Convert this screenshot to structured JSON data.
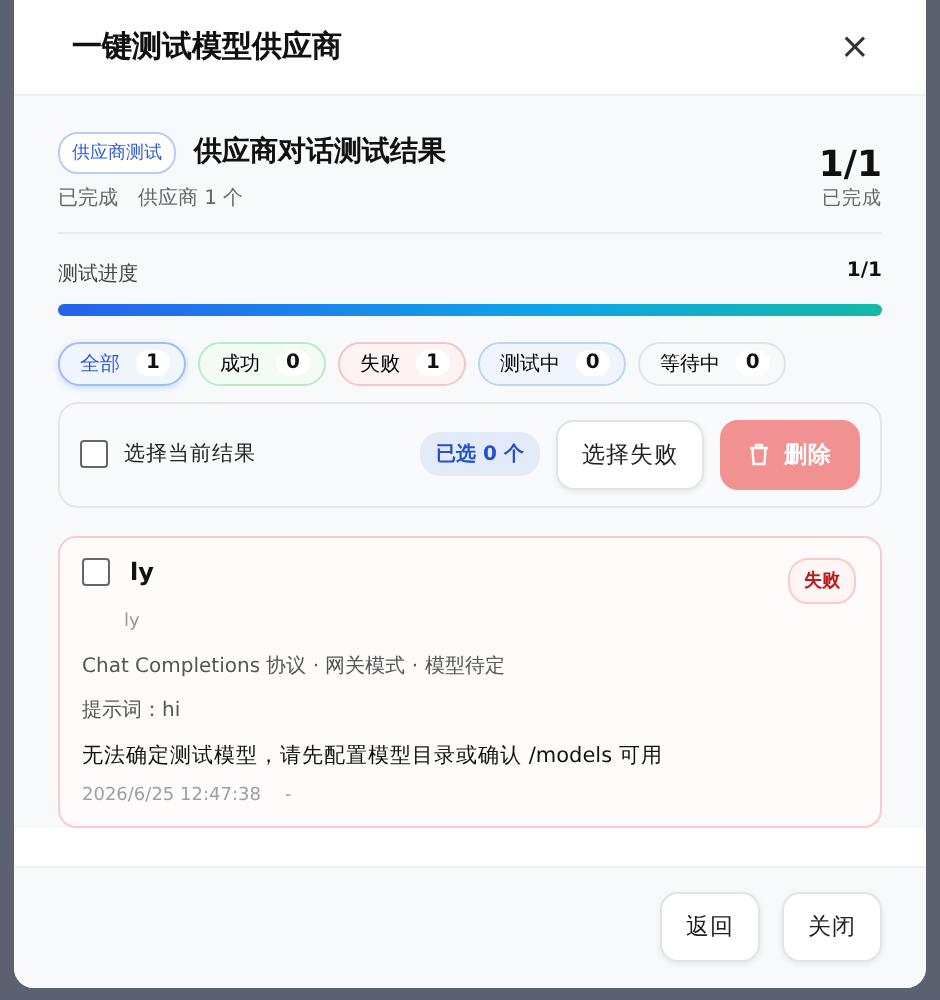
{
  "dialog": {
    "title": "一键测试模型供应商",
    "close": "×"
  },
  "summary": {
    "tag": "供应商测试",
    "title": "供应商对话测试结果",
    "status": "已完成",
    "providers": "供应商 1 个",
    "count": "1/1",
    "count_label": "已完成"
  },
  "progress": {
    "label": "测试进度",
    "value": "1/1",
    "level": 1
  },
  "filters": [
    {
      "label": "全部",
      "count": "1",
      "kind": "all",
      "selected": true
    },
    {
      "label": "成功",
      "count": "0",
      "kind": "success",
      "selected": false
    },
    {
      "label": "失败",
      "count": "1",
      "kind": "failed",
      "selected": false
    },
    {
      "label": "测试中",
      "count": "0",
      "kind": "running",
      "selected": false
    },
    {
      "label": "等待中",
      "count": "0",
      "kind": "waiting",
      "selected": false
    }
  ],
  "selection": {
    "label": "选择当前结果",
    "checked": false,
    "selected_count": "已选 0 个",
    "select_failed": "选择失败",
    "delete": "删除",
    "delete_disabled": true
  },
  "results": [
    {
      "name": "ly",
      "subtitle": "ly",
      "checked": false,
      "status": "失败",
      "kind": "failed",
      "meta": "Chat Completions 协议 · 网关模式 · 模型待定",
      "prompt": "提示词：hi",
      "message": "无法确定测试模型，请先配置模型目录或确认 /models 可用",
      "time": "2026/6/25 12:47:38",
      "duration": "-"
    }
  ],
  "buttons": [
    "返回",
    "关闭"
  ]
}
